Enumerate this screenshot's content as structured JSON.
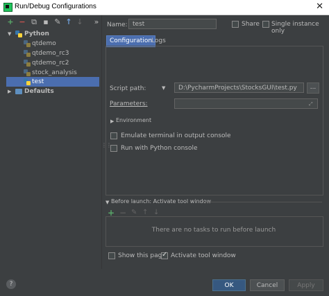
{
  "window": {
    "title": "Run/Debug Configurations",
    "close_glyph": "✕"
  },
  "toolbar": {
    "add_glyph": "+",
    "remove_glyph": "−",
    "copy_glyph": "⧉",
    "save_glyph": "▪",
    "edit_glyph": "✎",
    "up_glyph": "↑",
    "down_glyph": "↓",
    "more_glyph": "»"
  },
  "tree": {
    "root": {
      "label": "Python",
      "expanded_glyph": "▼"
    },
    "items": [
      {
        "label": "qtdemo"
      },
      {
        "label": "qtdemo_rc3"
      },
      {
        "label": "qtdemo_rc2"
      },
      {
        "label": "stock_analysis"
      },
      {
        "label": "test"
      }
    ],
    "defaults": {
      "label": "Defaults",
      "collapsed_glyph": "▶"
    }
  },
  "header": {
    "name_label": "Name:",
    "name_value": "test",
    "share_label": "Share",
    "single_instance_label": "Single instance only"
  },
  "tabs": [
    {
      "label": "Configuration"
    },
    {
      "label": "Logs"
    }
  ],
  "config": {
    "script_path_label": "Script path:",
    "script_path_value": "D:\\PycharmProjects\\StocksGUI\\test.py",
    "browse_glyph": "...",
    "parameters_label": "Parameters:",
    "parameters_value": "",
    "expand_glyph": "⤢",
    "environment_label": "Environment",
    "emulate_terminal_label": "Emulate terminal in output console",
    "python_console_label": "Run with Python console"
  },
  "before_launch": {
    "title": "Before launch: Activate tool window",
    "empty_text": "There are no tasks to run before launch",
    "toolbar": {
      "add": "+",
      "remove": "−",
      "edit": "✎",
      "up": "↑",
      "down": "↓"
    }
  },
  "footer": {
    "show_page_label": "Show this page",
    "activate_tool_label": "Activate tool window",
    "ok_label": "OK",
    "cancel_label": "Cancel",
    "apply_label": "Apply",
    "help_glyph": "?"
  },
  "colors": {
    "background": "#3c3f41",
    "selection": "#4b6eaf",
    "primary_button": "#365880",
    "add_green": "#59a869",
    "remove_red": "#c75450"
  }
}
